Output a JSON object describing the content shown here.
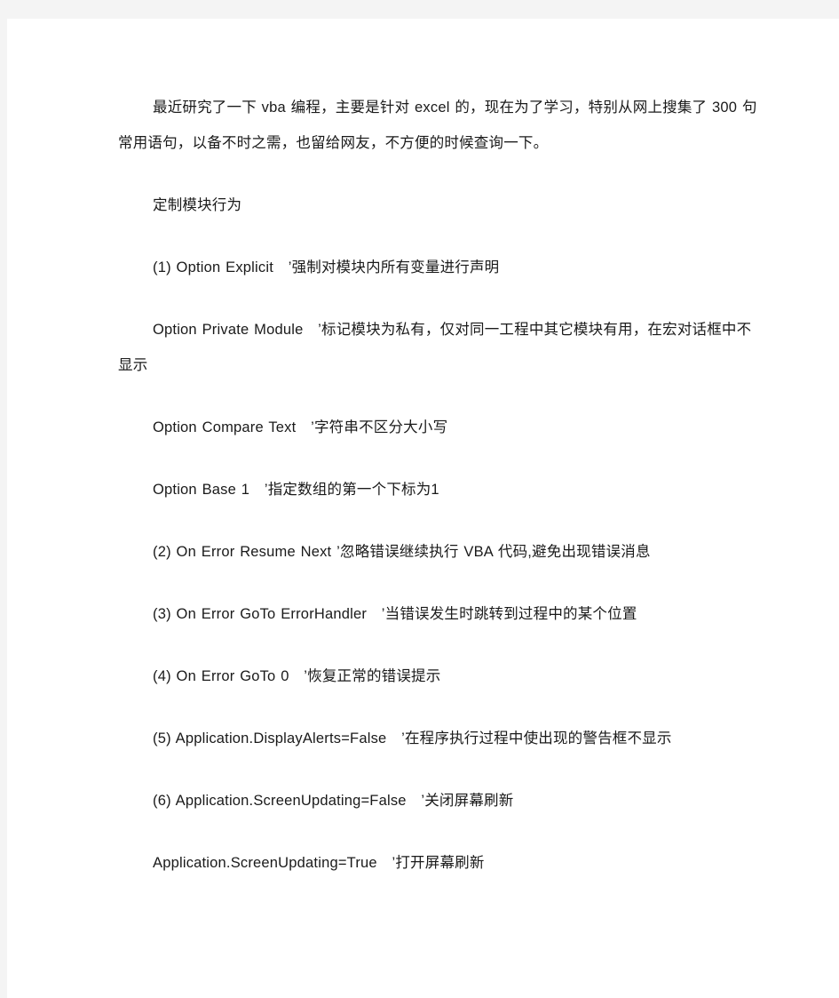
{
  "page": {
    "background_color": "#ffffff",
    "frame_color": "#f4f4f4",
    "text_color": "#1a1a1a"
  },
  "document": {
    "paragraphs": [
      {
        "id": "intro",
        "text": "最近研究了一下 vba 编程，主要是针对 excel 的，现在为了学习，特别从网上搜集了 300 句常用语句，以备不时之需，也留给网友，不方便的时候查询一下。"
      },
      {
        "id": "section-heading",
        "text": "定制模块行为"
      },
      {
        "id": "item-1",
        "text": "(1) Option Explicit　’强制对模块内所有变量进行声明"
      },
      {
        "id": "item-1b",
        "text": "Option Private Module　’标记模块为私有，仅对同一工程中其它模块有用，在宏对话框中不显示"
      },
      {
        "id": "item-1c",
        "text": "Option Compare Text　’字符串不区分大小写"
      },
      {
        "id": "item-1d",
        "text": "Option Base 1　’指定数组的第一个下标为1"
      },
      {
        "id": "item-2",
        "text": "(2) On Error Resume Next ’忽略错误继续执行 VBA 代码,避免出现错误消息"
      },
      {
        "id": "item-3",
        "text": "(3) On Error GoTo ErrorHandler　’当错误发生时跳转到过程中的某个位置"
      },
      {
        "id": "item-4",
        "text": "(4) On Error GoTo 0　’恢复正常的错误提示"
      },
      {
        "id": "item-5",
        "text": "(5) Application.DisplayAlerts=False　’在程序执行过程中使出现的警告框不显示"
      },
      {
        "id": "item-6",
        "text": "(6) Application.ScreenUpdating=False　’关闭屏幕刷新"
      },
      {
        "id": "item-6b",
        "text": "Application.ScreenUpdating=True　’打开屏幕刷新"
      }
    ]
  }
}
